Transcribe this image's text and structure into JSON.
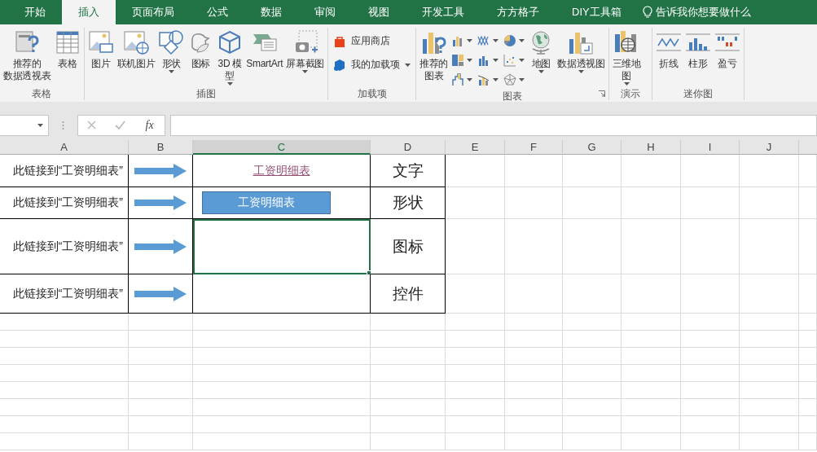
{
  "ribbon_tabs": [
    {
      "label": "开始",
      "selected": false
    },
    {
      "label": "插入",
      "selected": true
    },
    {
      "label": "页面布局",
      "selected": false
    },
    {
      "label": "公式",
      "selected": false
    },
    {
      "label": "数据",
      "selected": false
    },
    {
      "label": "审阅",
      "selected": false
    },
    {
      "label": "视图",
      "selected": false
    },
    {
      "label": "开发工具",
      "selected": false
    },
    {
      "label": "方方格子",
      "selected": false
    },
    {
      "label": "DIY工具箱",
      "selected": false
    }
  ],
  "tell_me": "告诉我你想要做什么",
  "ribbon_groups": [
    {
      "label": "表格",
      "items": [
        {
          "kind": "large",
          "lines": [
            "推荐的",
            "数据透视表"
          ],
          "dropdown": false
        },
        {
          "kind": "large",
          "lines": [
            "表格"
          ],
          "dropdown": false
        }
      ]
    },
    {
      "label": "插图",
      "items": [
        {
          "kind": "large",
          "lines": [
            "图片"
          ],
          "dropdown": false
        },
        {
          "kind": "large",
          "lines": [
            "联机图片"
          ],
          "dropdown": false
        },
        {
          "kind": "large",
          "lines": [
            "形状"
          ],
          "dropdown": true
        },
        {
          "kind": "large",
          "lines": [
            "图标"
          ],
          "dropdown": false
        },
        {
          "kind": "large",
          "lines": [
            "3D 模",
            "型"
          ],
          "dropdown": true
        },
        {
          "kind": "large",
          "lines": [
            "SmartArt"
          ],
          "dropdown": false
        },
        {
          "kind": "large",
          "lines": [
            "屏幕截图"
          ],
          "dropdown": true
        }
      ]
    },
    {
      "label": "加载项",
      "items": [
        {
          "kind": "small",
          "lines": [
            "应用商店"
          ],
          "dropdown": false
        },
        {
          "kind": "small",
          "lines": [
            "我的加载项"
          ],
          "dropdown": true
        }
      ]
    },
    {
      "label": "图表",
      "launcher": true,
      "items": [
        {
          "kind": "large",
          "lines": [
            "推荐的",
            "图表"
          ],
          "dropdown": false
        },
        {
          "kind": "icon",
          "dropdown": true
        },
        {
          "kind": "icon",
          "dropdown": true
        },
        {
          "kind": "icon",
          "dropdown": true
        },
        {
          "kind": "icon",
          "dropdown": true
        },
        {
          "kind": "icon",
          "dropdown": true
        },
        {
          "kind": "icon",
          "dropdown": true
        },
        {
          "kind": "icon",
          "dropdown": true
        },
        {
          "kind": "icon",
          "dropdown": true
        },
        {
          "kind": "icon",
          "dropdown": true
        },
        {
          "kind": "large",
          "lines": [
            "地图"
          ],
          "dropdown": true
        },
        {
          "kind": "large",
          "lines": [
            "数据透视图"
          ],
          "dropdown": true
        }
      ]
    },
    {
      "label": "演示",
      "items": [
        {
          "kind": "large",
          "lines": [
            "三维地",
            "图"
          ],
          "dropdown": true
        }
      ]
    },
    {
      "label": "迷你图",
      "items": [
        {
          "kind": "large",
          "lines": [
            "折线"
          ],
          "dropdown": false
        },
        {
          "kind": "large",
          "lines": [
            "柱形"
          ],
          "dropdown": false
        },
        {
          "kind": "large",
          "lines": [
            "盈亏"
          ],
          "dropdown": false
        }
      ]
    }
  ],
  "formula_bar": {
    "function_button": "fx"
  },
  "columns": [
    {
      "label": "A",
      "selected": false
    },
    {
      "label": "B",
      "selected": false
    },
    {
      "label": "C",
      "selected": true
    },
    {
      "label": "D",
      "selected": false
    },
    {
      "label": "E",
      "selected": false
    },
    {
      "label": "F",
      "selected": false
    },
    {
      "label": "G",
      "selected": false
    },
    {
      "label": "H",
      "selected": false
    },
    {
      "label": "I",
      "selected": false
    },
    {
      "label": "J",
      "selected": false
    }
  ],
  "rows": [
    {
      "a": "此链接到“工资明细表”",
      "arrow": true,
      "c": {
        "kind": "link",
        "text": "工资明细表",
        "selected": false
      },
      "d": "文字"
    },
    {
      "a": "此链接到“工资明细表”",
      "arrow": true,
      "c": {
        "kind": "shape",
        "text": "工资明细表",
        "selected": false
      },
      "d": "形状"
    },
    {
      "a": "此链接到“工资明细表”",
      "arrow": true,
      "c": {
        "kind": "empty",
        "selected": true
      },
      "d": "图标"
    },
    {
      "a": "此链接到“工资明细表”",
      "arrow": true,
      "c": {
        "kind": "empty",
        "selected": false
      },
      "d": "控件"
    }
  ]
}
